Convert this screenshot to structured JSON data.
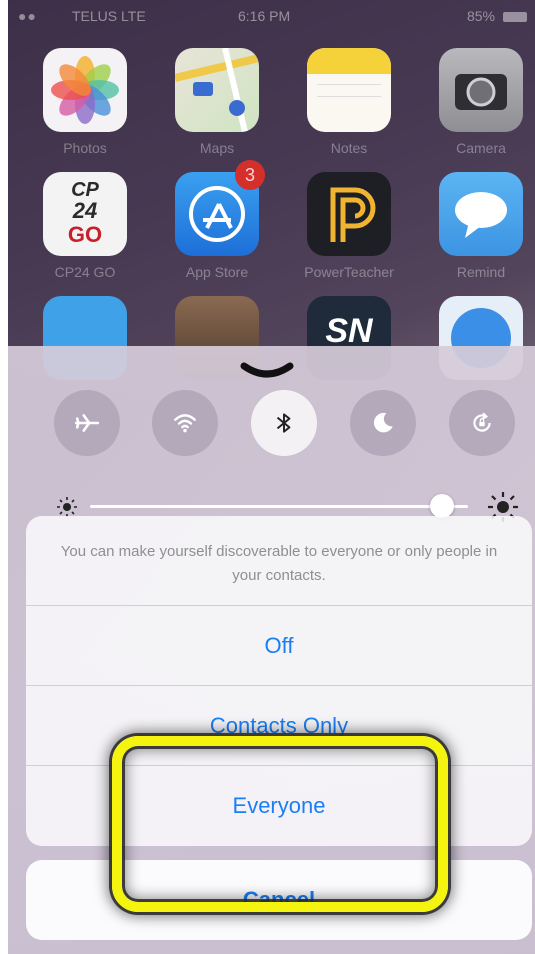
{
  "status_bar": {
    "carrier": "TELUS LTE",
    "time": "6:16 PM",
    "battery": "85%"
  },
  "home_apps": [
    {
      "label": "Photos"
    },
    {
      "label": "Maps"
    },
    {
      "label": "Notes"
    },
    {
      "label": "Camera"
    },
    {
      "label": "CP24 GO",
      "tile_text_top": "CP",
      "tile_text_mid": "24",
      "tile_text_bottom": "GO"
    },
    {
      "label": "App Store",
      "badge": "3"
    },
    {
      "label": "PowerTeacher"
    },
    {
      "label": "Remind"
    },
    {
      "label": ""
    },
    {
      "label": ""
    },
    {
      "label": "",
      "tile_text": "SN"
    },
    {
      "label": ""
    }
  ],
  "control_center": {
    "toggles": [
      {
        "icon": "airplane-icon",
        "active": false
      },
      {
        "icon": "wifi-icon",
        "active": false
      },
      {
        "icon": "bluetooth-icon",
        "active": true
      },
      {
        "icon": "moon-icon",
        "active": false
      },
      {
        "icon": "rotation-lock-icon",
        "active": false
      }
    ],
    "brightness_fraction": 0.93
  },
  "action_sheet": {
    "message": "You can make yourself discoverable to everyone or only people in your contacts.",
    "options": [
      "Off",
      "Contacts Only",
      "Everyone"
    ],
    "cancel_label": "Cancel"
  },
  "colors": {
    "accent": "#1a7ff5",
    "highlight": "#f4f40f",
    "badge": "#d52f2c"
  }
}
